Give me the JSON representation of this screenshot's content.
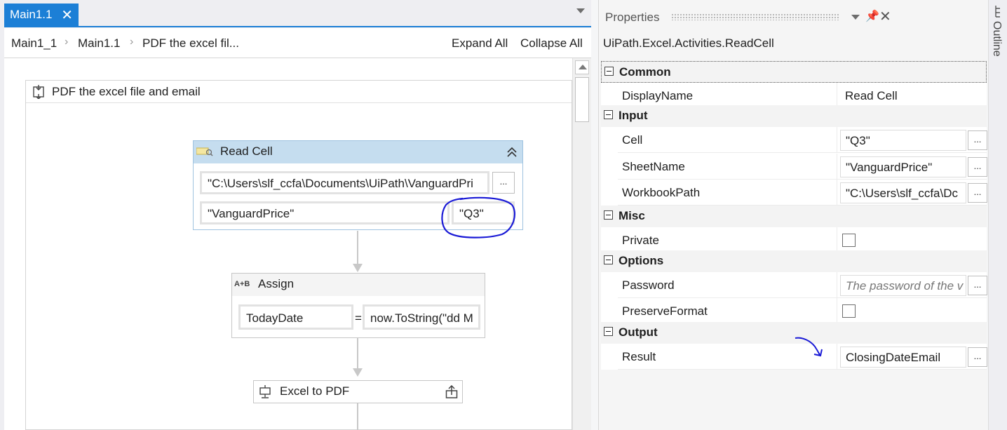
{
  "tabs": [
    {
      "label": "Main1.1",
      "close": "✕"
    }
  ],
  "breadcrumb": [
    "Main1_1",
    "Main1.1",
    "PDF the excel fil..."
  ],
  "breadcrumb_sep": "›",
  "toolbar": {
    "expand_all": "Expand All",
    "collapse_all": "Collapse All"
  },
  "sequence": {
    "title": "PDF the excel file and email"
  },
  "read_cell": {
    "title": "Read Cell",
    "workbook_path": "\"C:\\Users\\slf_ccfa\\Documents\\UiPath\\VanguardPri",
    "sheet": "\"VanguardPrice\"",
    "cell": "\"Q3\"",
    "dots": "..."
  },
  "assign": {
    "title": "Assign",
    "icon_text": "A+B",
    "to": "TodayDate",
    "eq": "=",
    "value": "now.ToString(\"dd M"
  },
  "excel_to_pdf": {
    "title": "Excel to PDF"
  },
  "properties": {
    "title": "Properties",
    "type": "UiPath.Excel.Activities.ReadCell",
    "categories": [
      {
        "label": "Common",
        "rows": [
          {
            "name": "DisplayName",
            "value": "Read Cell",
            "kind": "plain"
          }
        ]
      },
      {
        "label": "Input",
        "rows": [
          {
            "name": "Cell",
            "value": "\"Q3\"",
            "kind": "box"
          },
          {
            "name": "SheetName",
            "value": "\"VanguardPrice\"",
            "kind": "box"
          },
          {
            "name": "WorkbookPath",
            "value": "\"C:\\Users\\slf_ccfa\\Dc",
            "kind": "box"
          }
        ]
      },
      {
        "label": "Misc",
        "rows": [
          {
            "name": "Private",
            "value": "",
            "kind": "check"
          }
        ]
      },
      {
        "label": "Options",
        "rows": [
          {
            "name": "Password",
            "value": "The password of the v",
            "kind": "placeholder"
          },
          {
            "name": "PreserveFormat",
            "value": "",
            "kind": "check"
          }
        ]
      },
      {
        "label": "Output",
        "rows": [
          {
            "name": "Result",
            "value": "ClosingDateEmail",
            "kind": "box"
          }
        ]
      }
    ]
  },
  "outline_tab": "Outline",
  "colors": {
    "accent": "#1c7fd6",
    "activity_header": "#c5ddef",
    "annotation": "#1a1ad6"
  }
}
